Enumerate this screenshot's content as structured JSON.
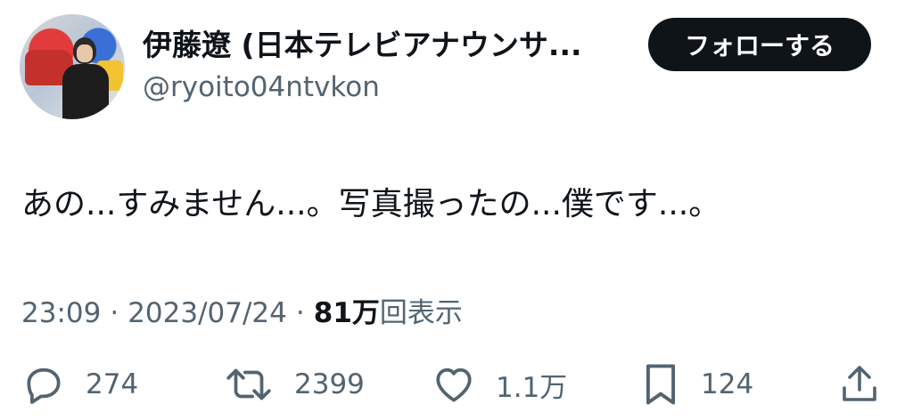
{
  "tweet": {
    "display_name": "伊藤遼 (日本テレビアナウンサ...",
    "handle": "@ryoito04ntvkon",
    "follow_label": "フォローする",
    "text": "あの...すみません...。写真撮ったの...僕です...。",
    "time": "23:09",
    "separator": "·",
    "date": "2023/07/24",
    "views_count": "81万",
    "views_label": "回表示"
  },
  "actions": {
    "reply": {
      "icon": "reply-icon",
      "count": "274"
    },
    "retweet": {
      "icon": "retweet-icon",
      "count": "2399"
    },
    "like": {
      "icon": "heart-icon",
      "count": "1.1万"
    },
    "bookmark": {
      "icon": "bookmark-icon",
      "count": "124"
    },
    "share": {
      "icon": "share-icon"
    }
  },
  "colors": {
    "text": "#0f1419",
    "secondary": "#536471",
    "button_bg": "#0f1419",
    "button_text": "#ffffff",
    "background": "#ffffff"
  }
}
